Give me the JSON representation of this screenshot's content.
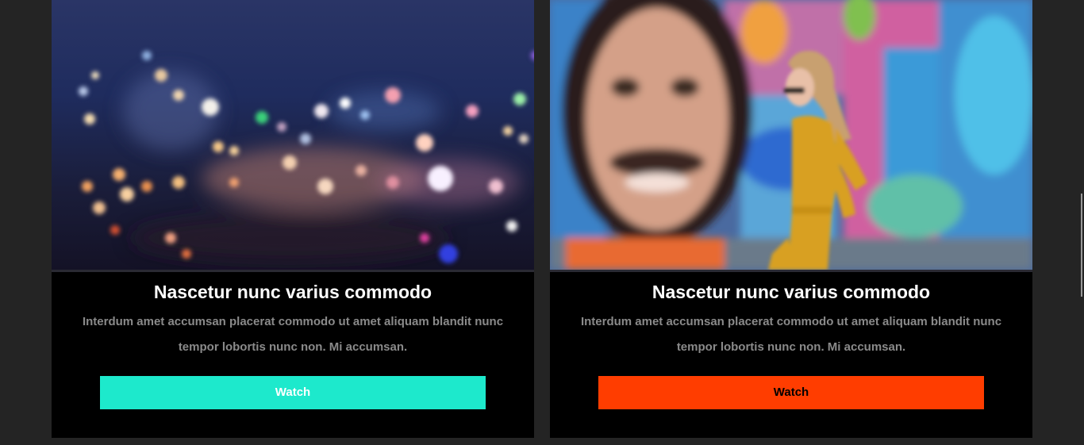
{
  "cards": [
    {
      "title": "Nascetur nunc varius commodo",
      "description": "Interdum amet accumsan placerat commodo ut amet aliquam blandit nunc tempor lobortis nunc non. Mi accumsan.",
      "button_label": "Watch",
      "button_color": "#1de9cc",
      "button_text_color": "#ffffff",
      "image_icon": "city-night-bokeh-image"
    },
    {
      "title": "Nascetur nunc varius commodo",
      "description": "Interdum amet accumsan placerat commodo ut amet aliquam blandit nunc tempor lobortis nunc non. Mi accumsan.",
      "button_label": "Watch",
      "button_color": "#ff3d00",
      "button_text_color": "#000000",
      "image_icon": "street-mural-woman-image"
    }
  ],
  "colors": {
    "page_background": "#242424",
    "card_background": "#000000",
    "title_text": "#ffffff",
    "description_text": "#8a8a8a"
  }
}
